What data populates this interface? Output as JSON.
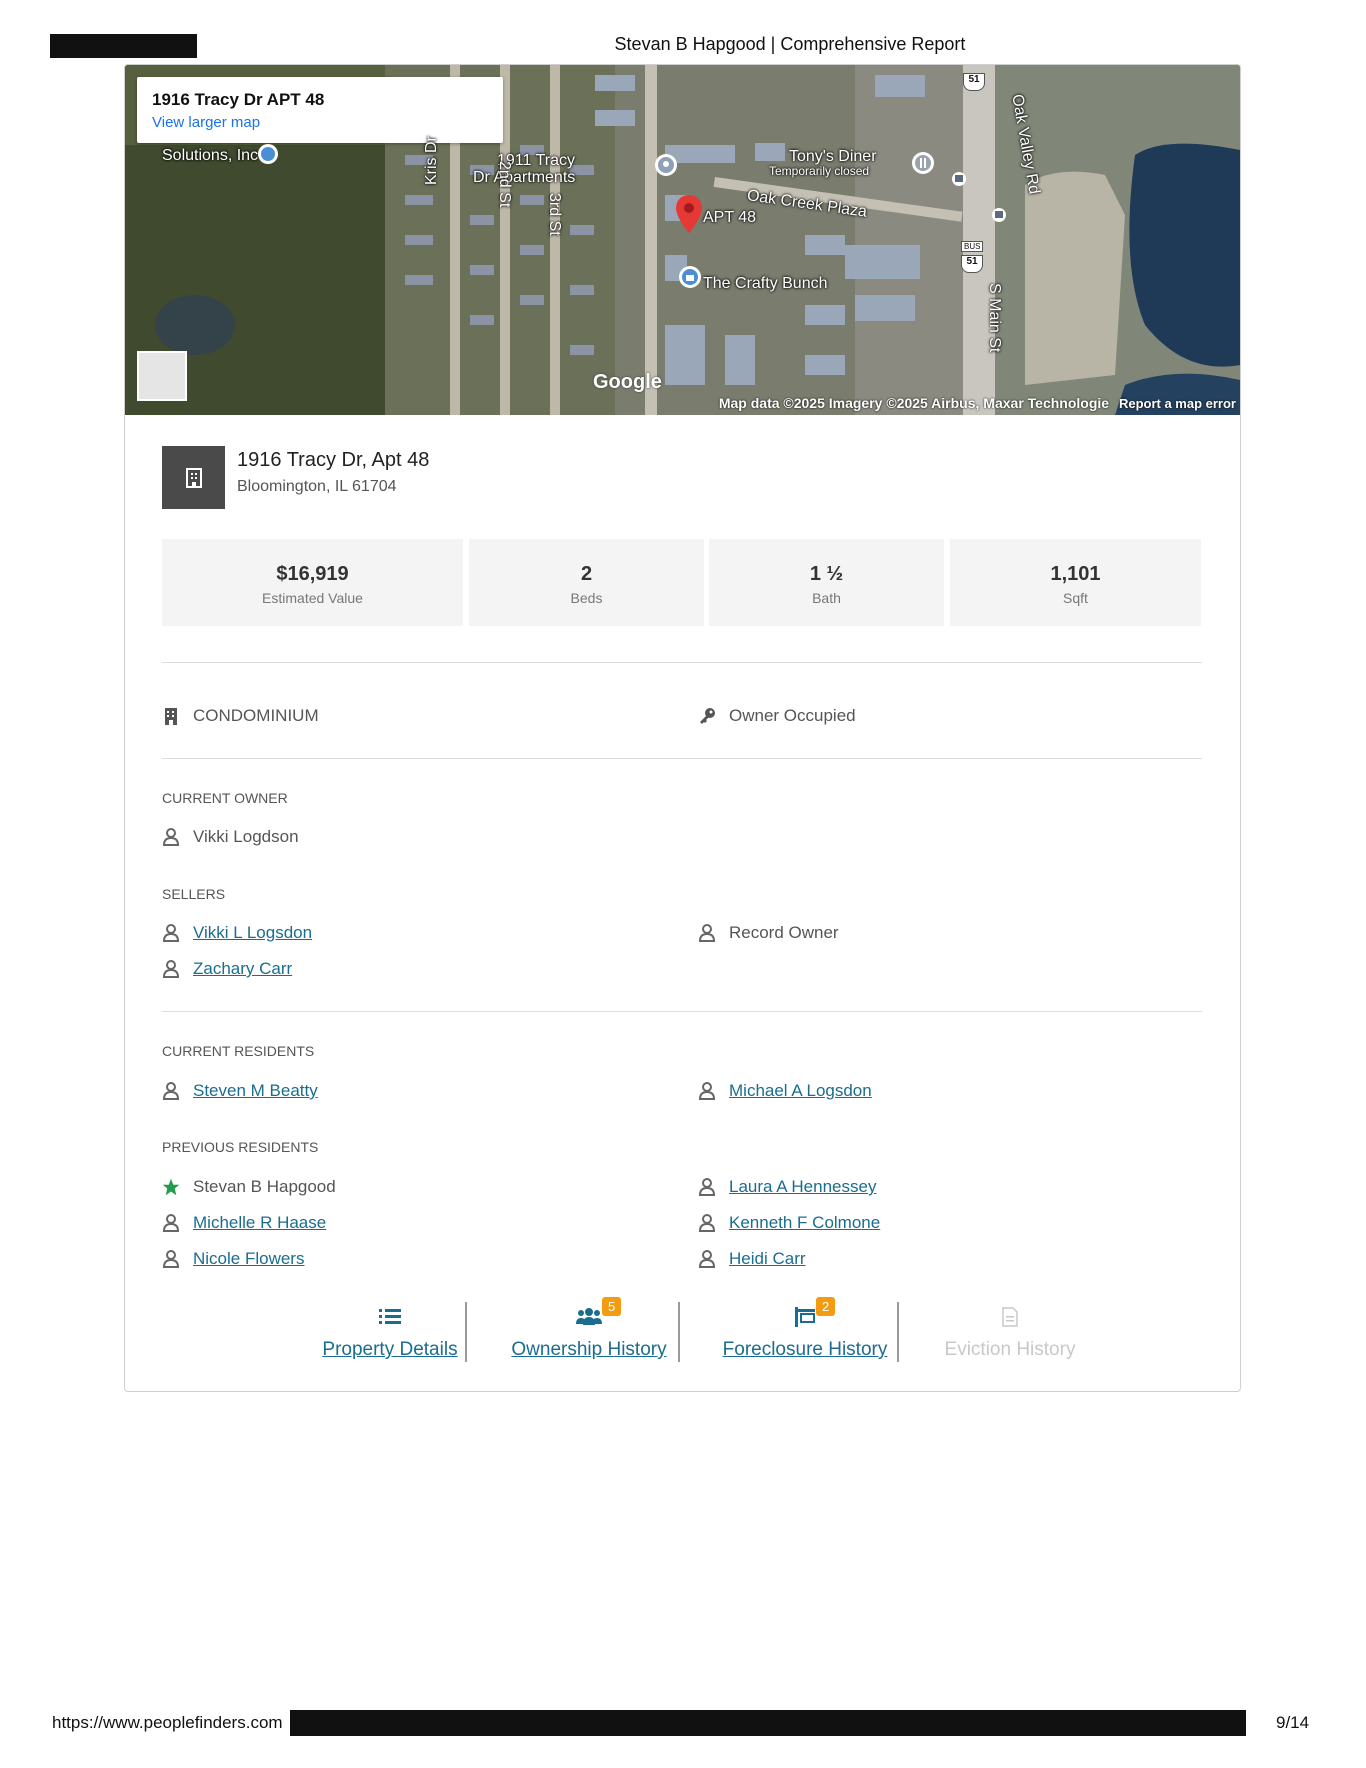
{
  "header": {
    "title": "Stevan B Hapgood | Comprehensive Report"
  },
  "map": {
    "box_title": "1916 Tracy Dr APT 48",
    "box_link": "View larger map",
    "labels": {
      "solutions": "Solutions, Inc",
      "tracy_apts_1": "1911 Tracy",
      "tracy_apts_2": "Dr Apartments",
      "tonys": "Tony's Diner",
      "tonys_status": "Temporarily closed",
      "oak_creek": "Oak Creek Plaza",
      "apt48": "APT 48",
      "crafty": "The Crafty Bunch",
      "kris_dr": "Kris Dr",
      "second_st": "2nd St",
      "third_st": "3rd St",
      "oak_valley": "Oak Valley Rd",
      "s_main": "S Main St",
      "route51": "51",
      "bus": "BUS"
    },
    "google": "Google",
    "attribution": "Map data ©2025 Imagery ©2025 Airbus, Maxar Technologie",
    "report": "Report a map error"
  },
  "property": {
    "address_line1": "1916 Tracy Dr, Apt 48",
    "address_line2": "Bloomington, IL 61704",
    "stats": [
      {
        "value": "$16,919",
        "label": "Estimated Value"
      },
      {
        "value": "2",
        "label": "Beds"
      },
      {
        "value": "1 ½",
        "label": "Bath"
      },
      {
        "value": "1,101",
        "label": "Sqft"
      }
    ],
    "type": "CONDOMINIUM",
    "occupancy": "Owner Occupied"
  },
  "current_owner": {
    "heading": "CURRENT OWNER",
    "name": "Vikki Logdson"
  },
  "sellers": {
    "heading": "SELLERS",
    "names": [
      "Vikki L Logsdon",
      "Zachary Carr"
    ],
    "record_owner": "Record Owner"
  },
  "current_residents": {
    "heading": "CURRENT RESIDENTS",
    "names": [
      "Steven M Beatty",
      "Michael A Logsdon"
    ]
  },
  "previous_residents": {
    "heading": "PREVIOUS RESIDENTS",
    "left": [
      "Stevan B Hapgood",
      "Michelle R Haase",
      "Nicole Flowers"
    ],
    "right": [
      "Laura A Hennessey",
      "Kenneth F Colmone",
      "Heidi Carr"
    ]
  },
  "tabs": [
    {
      "label": "Property Details",
      "badge": ""
    },
    {
      "label": "Ownership History",
      "badge": "5"
    },
    {
      "label": "Foreclosure History",
      "badge": "2"
    },
    {
      "label": "Eviction History",
      "badge": ""
    }
  ],
  "footer": {
    "url": "https://www.peoplefinders.com",
    "page": "9/14"
  },
  "colors": {
    "link": "#1a6d8f",
    "badge": "#f39c12",
    "star": "#1e9e4a",
    "pin": "#e53935"
  }
}
